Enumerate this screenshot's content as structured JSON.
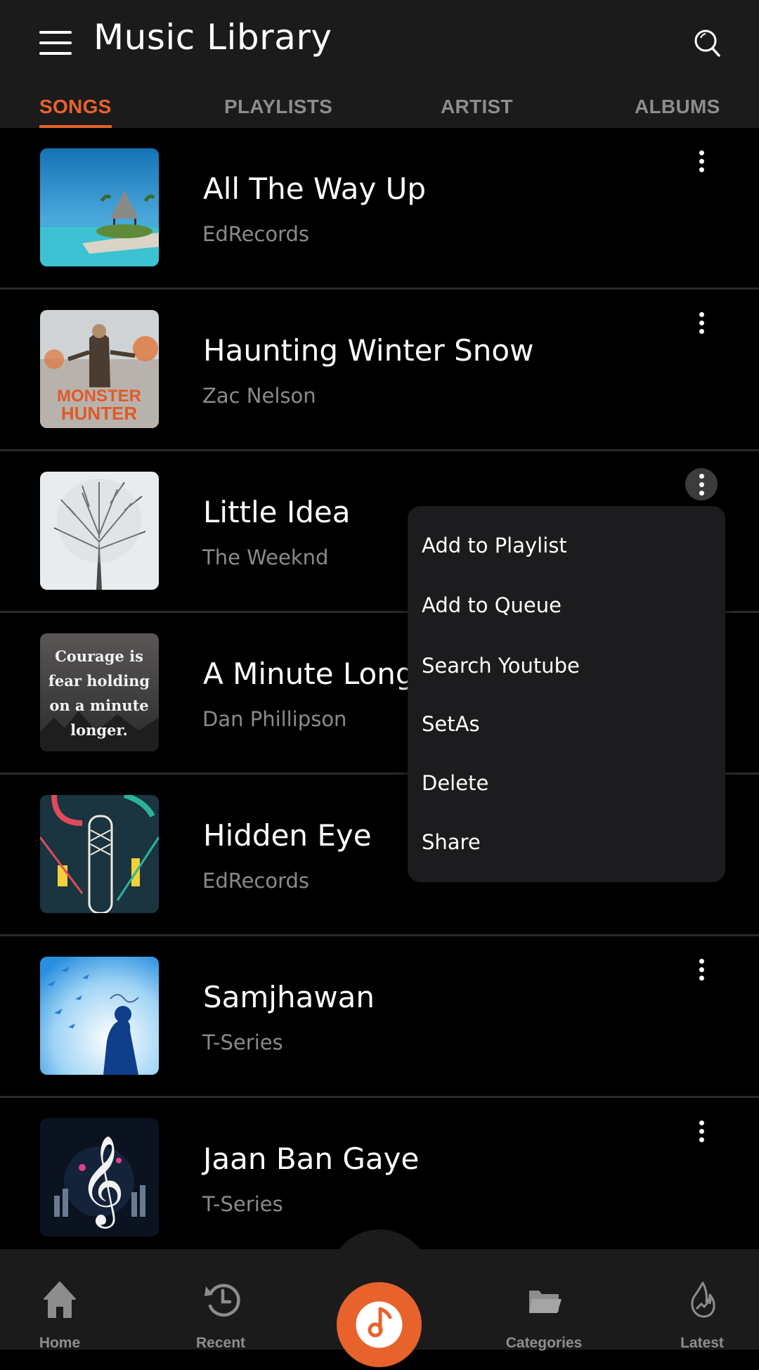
{
  "header": {
    "title": "Music Library",
    "menu_icon": "hamburger-menu-icon",
    "search_icon": "search-icon"
  },
  "tabs": [
    {
      "label": "SONGS",
      "active": true
    },
    {
      "label": "PLAYLISTS",
      "active": false
    },
    {
      "label": "ARTIST",
      "active": false
    },
    {
      "label": "ALBUMS",
      "active": false
    }
  ],
  "songs": [
    {
      "title": "All The Way Up",
      "artist": "EdRecords",
      "art": "tropical-beach-cover"
    },
    {
      "title": "Haunting Winter Snow",
      "artist": "Zac Nelson",
      "art": "monster-hunter-cover",
      "art_text": "MONSTER HUNTER"
    },
    {
      "title": "Little Idea",
      "artist": "The Weeknd",
      "art": "snowy-tree-cover"
    },
    {
      "title": "A Minute Longer",
      "artist": "Dan Phillipson",
      "art": "courage-quote-cover",
      "art_text": "Courage is fear holding on a minute longer."
    },
    {
      "title": "Hidden Eye",
      "artist": "EdRecords",
      "art": "illustrated-city-cover"
    },
    {
      "title": "Samjhawan",
      "artist": "T-Series",
      "art": "birds-silhouette-cover"
    },
    {
      "title": "Jaan Ban Gaye",
      "artist": "T-Series",
      "art": "treble-clef-cover"
    }
  ],
  "context_menu": {
    "open_for_song": "Little Idea",
    "items": [
      "Add to Playlist",
      "Add to Queue",
      "Search Youtube",
      "SetAs",
      "Delete",
      "Share"
    ]
  },
  "bottom_nav": {
    "items": [
      {
        "label": "Home",
        "icon": "home-icon"
      },
      {
        "label": "Recent",
        "icon": "history-icon"
      },
      {
        "label": "Categories",
        "icon": "folder-icon"
      },
      {
        "label": "Latest",
        "icon": "trending-flame-icon"
      }
    ],
    "center_button_icon": "music-disc-icon"
  },
  "colors": {
    "accent": "#e8622c",
    "header_bg": "#1c1b1c",
    "list_bg": "#000000",
    "secondary_text": "#8a8a8a",
    "inactive_tab": "#8d8d8d",
    "menu_bg": "#1c1b1d"
  }
}
